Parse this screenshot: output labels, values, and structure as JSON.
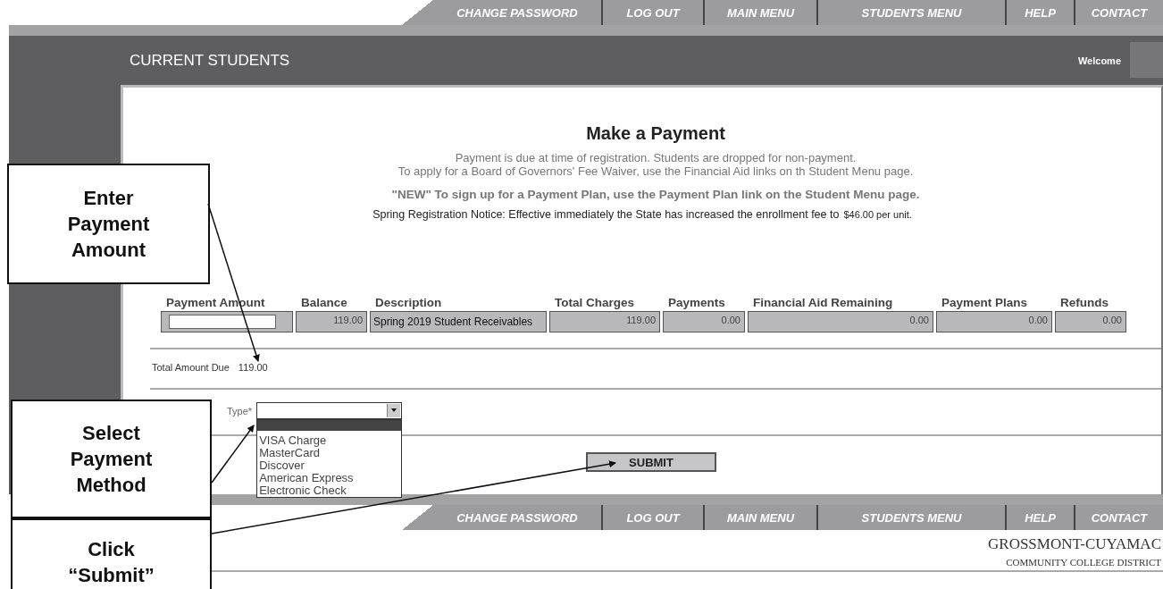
{
  "top_nav": [
    {
      "label": "CHANGE PASSWORD"
    },
    {
      "label": "LOG OUT"
    },
    {
      "label": "MAIN MENU"
    },
    {
      "label": "STUDENTS MENU"
    },
    {
      "label": "HELP"
    },
    {
      "label": "CONTACT"
    }
  ],
  "header": {
    "title": "CURRENT STUDENTS",
    "welcome": "Welcome"
  },
  "page_title": "Make a Payment",
  "notices": [
    "Payment is due at time of registration. Students are dropped for non-payment.",
    "To apply for a Board of Governors' Fee Waiver, use the Financial Aid links on th Student Menu page."
  ],
  "new_notice": "\"NEW\" To sign up for a Payment Plan, use the Payment Plan link on the Student Menu page.",
  "registration_notice": {
    "text": "Spring Registration Notice: Effective immediately the State has increased the enrollment fee to",
    "fee": "$46.00 per unit."
  },
  "table": {
    "columns": [
      "Payment Amount",
      "Balance",
      "Description",
      "Total Charges",
      "Payments",
      "Financial Aid Remaining",
      "Payment Plans",
      "Refunds"
    ],
    "row": [
      {
        "kind": "input"
      },
      {
        "kind": "number",
        "text": "119.00"
      },
      {
        "kind": "text",
        "text": "Spring 2019 Student Receivables"
      },
      {
        "kind": "number",
        "text": "119.00"
      },
      {
        "kind": "number",
        "text": "0.00"
      },
      {
        "kind": "number",
        "text": "0.00"
      },
      {
        "kind": "number",
        "text": "0.00"
      },
      {
        "kind": "number",
        "text": "0.00"
      }
    ]
  },
  "total": {
    "label": "Total Amount Due",
    "value": "119.00"
  },
  "payment_type": {
    "label": "Type*",
    "expanded": true,
    "options": [
      {
        "selected": true
      },
      {
        "label": "VISA Charge",
        "selected": false
      },
      {
        "label": "MasterCard",
        "selected": false
      },
      {
        "label": "Discover",
        "selected": false
      },
      {
        "label": "American Express",
        "selected": false
      },
      {
        "label": "Electronic Check",
        "selected": false
      }
    ]
  },
  "submit": "SUBMIT",
  "bottom_nav": [
    {
      "label": "CHANGE PASSWORD"
    },
    {
      "label": "LOG OUT"
    },
    {
      "label": "MAIN MENU"
    },
    {
      "label": "STUDENTS MENU"
    },
    {
      "label": "HELP"
    },
    {
      "label": "CONTACT"
    }
  ],
  "logo": {
    "name": "GROSSMONT-CUYAMAC",
    "subtitle": "COMMUNITY COLLEGE DISTRICT"
  },
  "callouts": [
    {
      "text": "Enter Payment Amount"
    },
    {
      "text": "Select Payment Method"
    },
    {
      "text": "Click “Submit”"
    }
  ]
}
